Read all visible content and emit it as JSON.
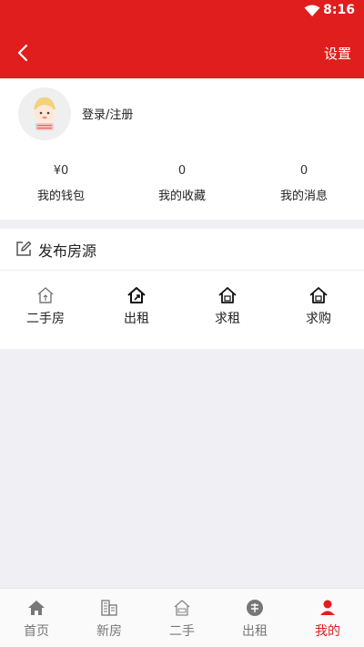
{
  "status_bar": {
    "time": "8:16"
  },
  "header": {
    "settings_label": "设置"
  },
  "profile": {
    "login_label": "登录/注册"
  },
  "stats": [
    {
      "value": "¥0",
      "label": "我的钱包"
    },
    {
      "value": "0",
      "label": "我的收藏"
    },
    {
      "value": "0",
      "label": "我的消息"
    }
  ],
  "publish": {
    "title": "发布房源",
    "items": [
      {
        "label": "二手房",
        "icon": "house-sale-icon"
      },
      {
        "label": "出租",
        "icon": "house-rent-out-icon"
      },
      {
        "label": "求租",
        "icon": "house-seek-rent-icon"
      },
      {
        "label": "求购",
        "icon": "house-seek-buy-icon"
      }
    ]
  },
  "tabs": [
    {
      "label": "首页",
      "icon": "home-icon"
    },
    {
      "label": "新房",
      "icon": "building-icon"
    },
    {
      "label": "二手",
      "icon": "house-sale-icon"
    },
    {
      "label": "出租",
      "icon": "rent-icon"
    },
    {
      "label": "我的",
      "icon": "person-icon",
      "active": true
    }
  ],
  "colors": {
    "primary": "#e01e1e",
    "background": "#f0eff4",
    "tab_inactive": "#777777"
  }
}
